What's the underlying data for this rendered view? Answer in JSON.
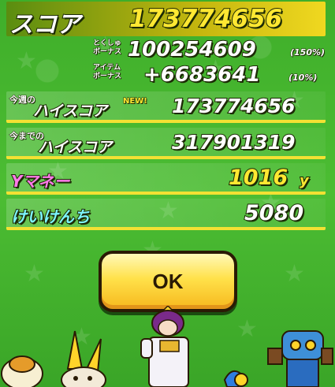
{
  "score": {
    "label": "スコア",
    "value": "173774656"
  },
  "bonus_special": {
    "label_line1": "とくしゅ",
    "label_line2": "ボーナス",
    "value": "100254609",
    "pct": "(150%)"
  },
  "bonus_item": {
    "label_line1": "アイテム",
    "label_line2": "ボーナス",
    "value": "+6683641",
    "pct": "(10%)"
  },
  "weekly_high": {
    "label_prefix": "今週の",
    "label": "ハイスコア",
    "badge": "NEW!",
    "value": "173774656"
  },
  "alltime_high": {
    "label_prefix": "今までの",
    "label": "ハイスコア",
    "value": "317901319"
  },
  "ymoney": {
    "label": "Yマネー",
    "value": "1016",
    "unit": "y"
  },
  "exp": {
    "label": "けいけんち",
    "value": "5080"
  },
  "ok_button": {
    "label": "OK"
  },
  "colors": {
    "background": "#3fae2a",
    "accent_yellow": "#ffe832",
    "button": "#ffe14a"
  }
}
